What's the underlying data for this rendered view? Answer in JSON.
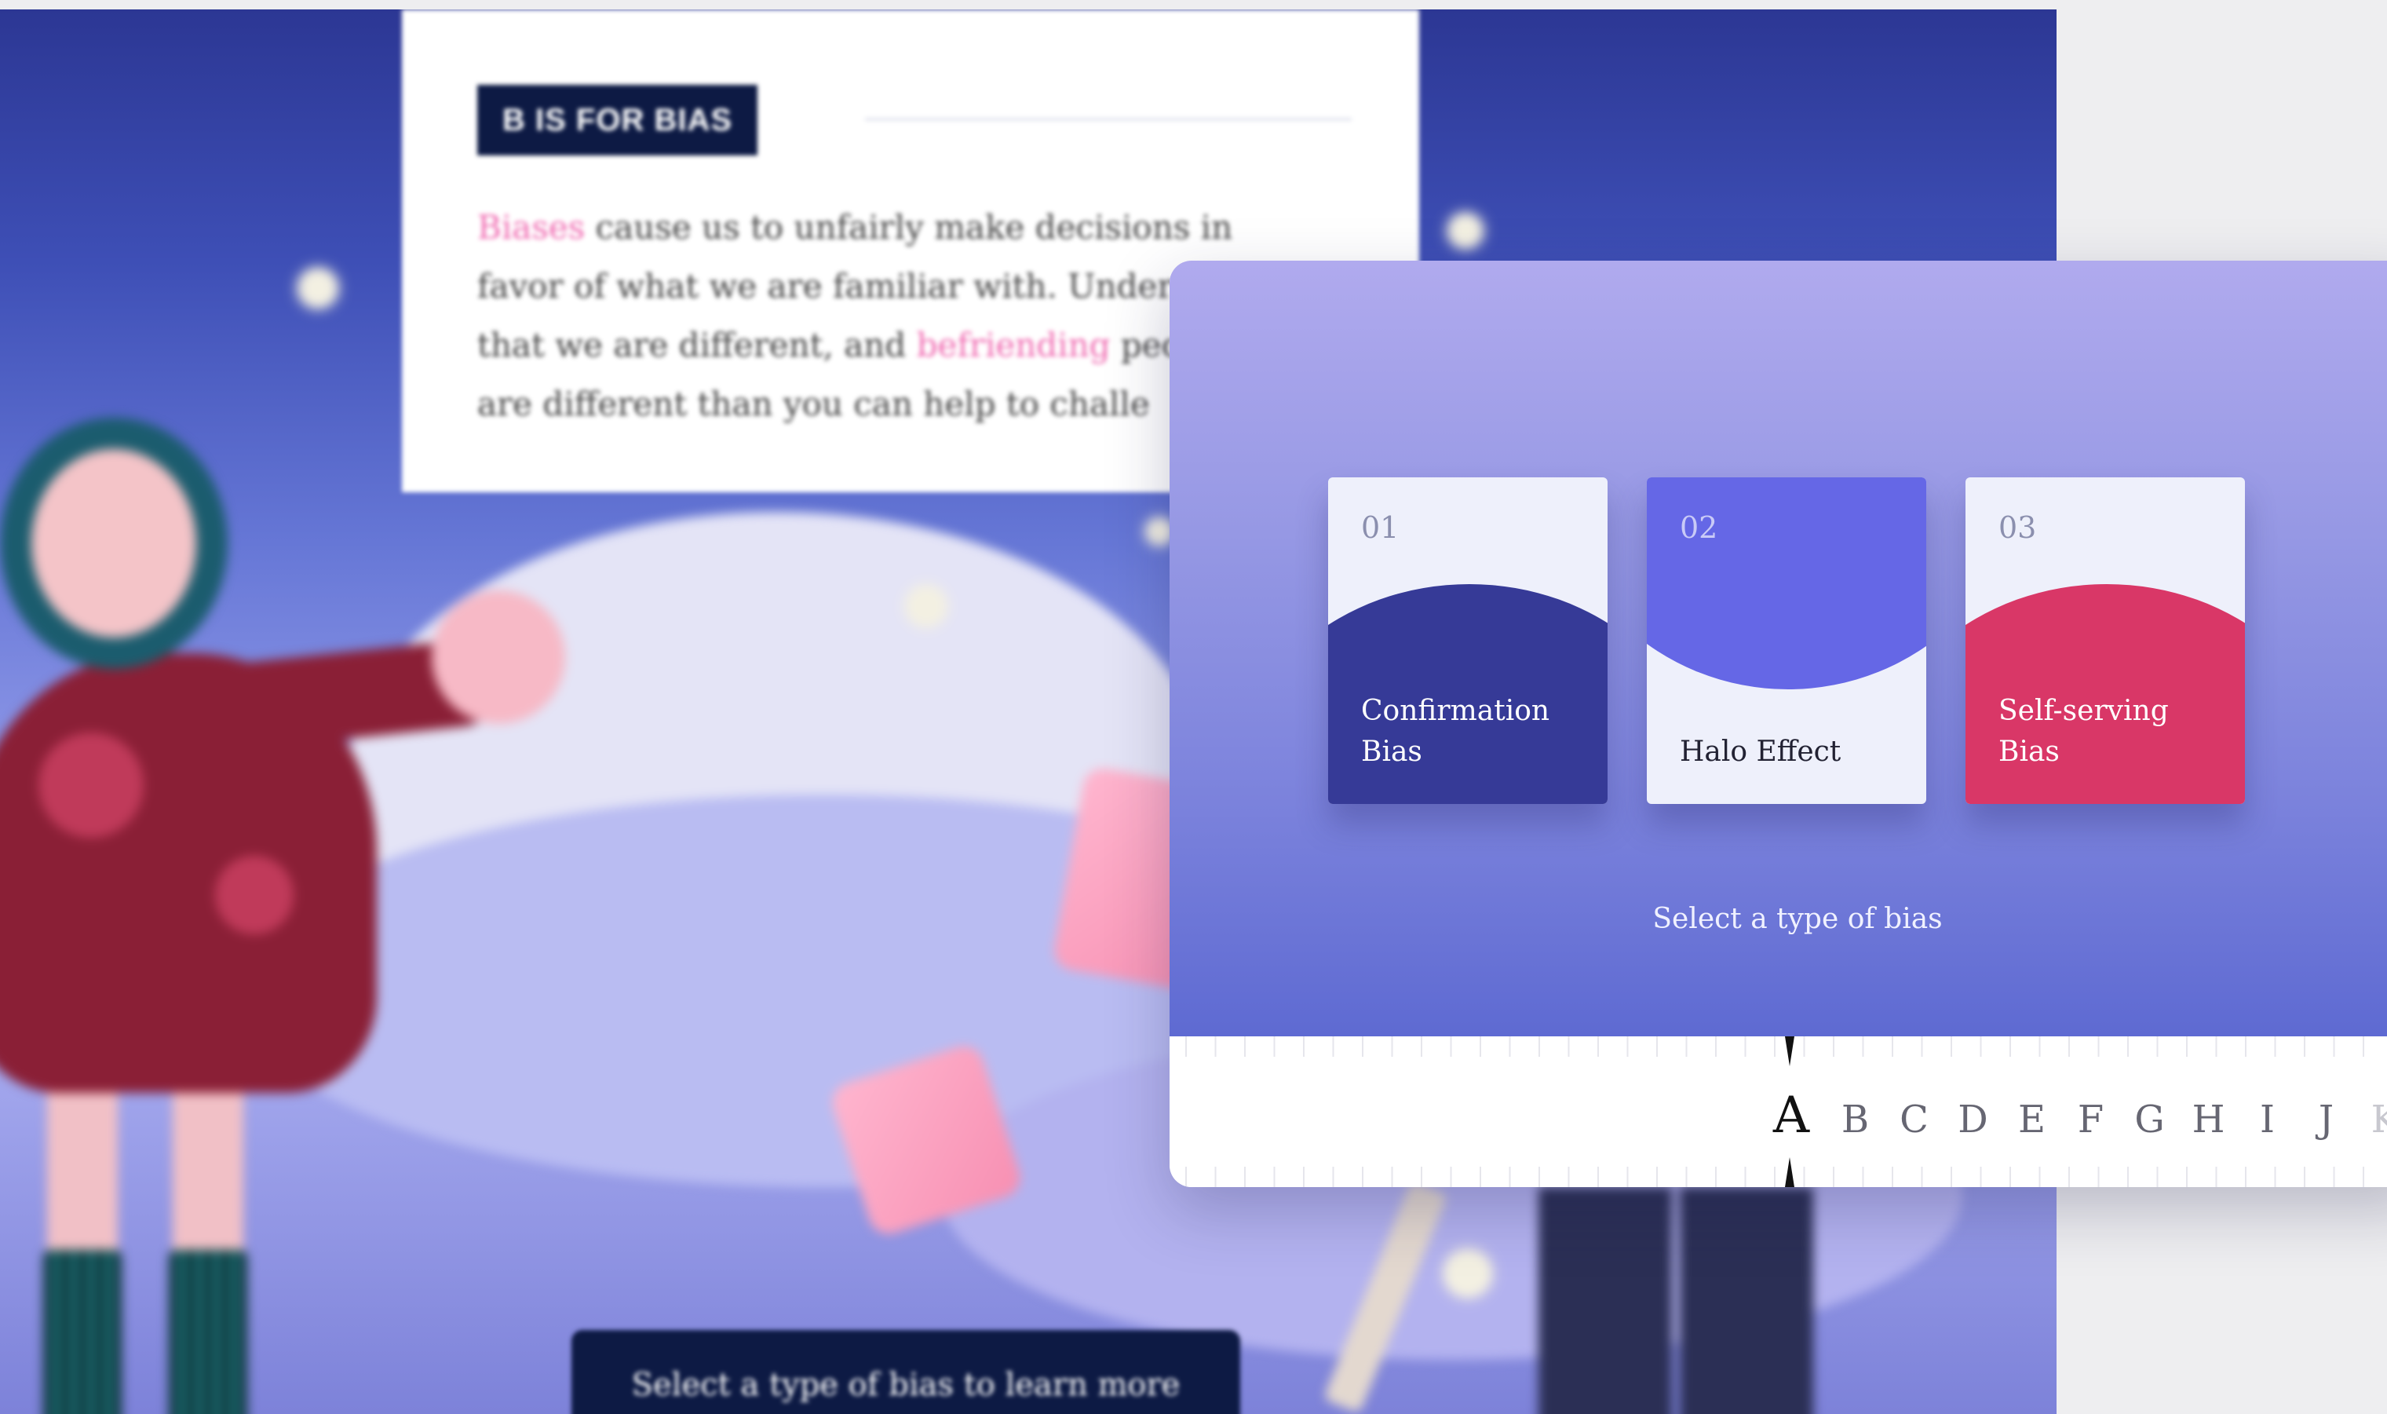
{
  "background": {
    "tag": "B IS FOR BIAS",
    "paragraph": {
      "highlight1": "Biases",
      "part1": " cause us to unfairly make decisions in favor of what we are familiar with. Under",
      "part2": "that we are different, and ",
      "highlight2": "befriending",
      "part3": " peo",
      "part4": "are different than you can help to challe"
    },
    "cta_label": "Select a type of bias to learn more"
  },
  "modal": {
    "cards": [
      {
        "number": "01",
        "label": "Confirmation Bias",
        "blob_color": "#363a97",
        "text_color": "#ffffff",
        "style": "bottom"
      },
      {
        "number": "02",
        "label": "Halo Effect",
        "blob_color": "#6567e6",
        "text_color": "#222233",
        "style": "top"
      },
      {
        "number": "03",
        "label": "Self-serving Bias",
        "blob_color": "#d93767",
        "text_color": "#ffffff",
        "style": "bottom"
      }
    ],
    "prompt": "Select a type of bias"
  },
  "alphabet": {
    "active": "A",
    "letters": [
      "A",
      "B",
      "C",
      "D",
      "E",
      "F",
      "G",
      "H",
      "I",
      "J",
      "K"
    ]
  },
  "colors": {
    "accent_pink": "#f06ab1",
    "navy": "#0d1a44"
  }
}
